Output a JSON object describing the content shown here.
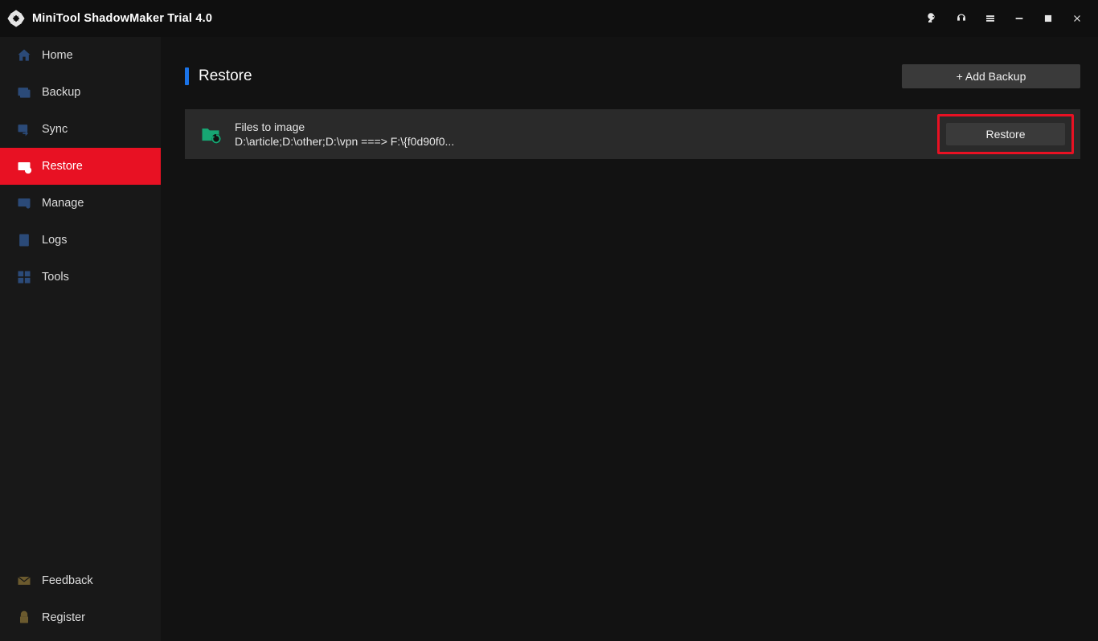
{
  "app": {
    "title": "MiniTool ShadowMaker Trial 4.0"
  },
  "sidebar": {
    "items": [
      {
        "label": "Home"
      },
      {
        "label": "Backup"
      },
      {
        "label": "Sync"
      },
      {
        "label": "Restore"
      },
      {
        "label": "Manage"
      },
      {
        "label": "Logs"
      },
      {
        "label": "Tools"
      }
    ],
    "footer": [
      {
        "label": "Feedback"
      },
      {
        "label": "Register"
      }
    ]
  },
  "main": {
    "page_title": "Restore",
    "add_backup_label": "+ Add Backup",
    "backups": [
      {
        "title": "Files to image",
        "detail": "D:\\article;D:\\other;D:\\vpn ===> F:\\{f0d90f0...",
        "restore_label": "Restore"
      }
    ]
  }
}
